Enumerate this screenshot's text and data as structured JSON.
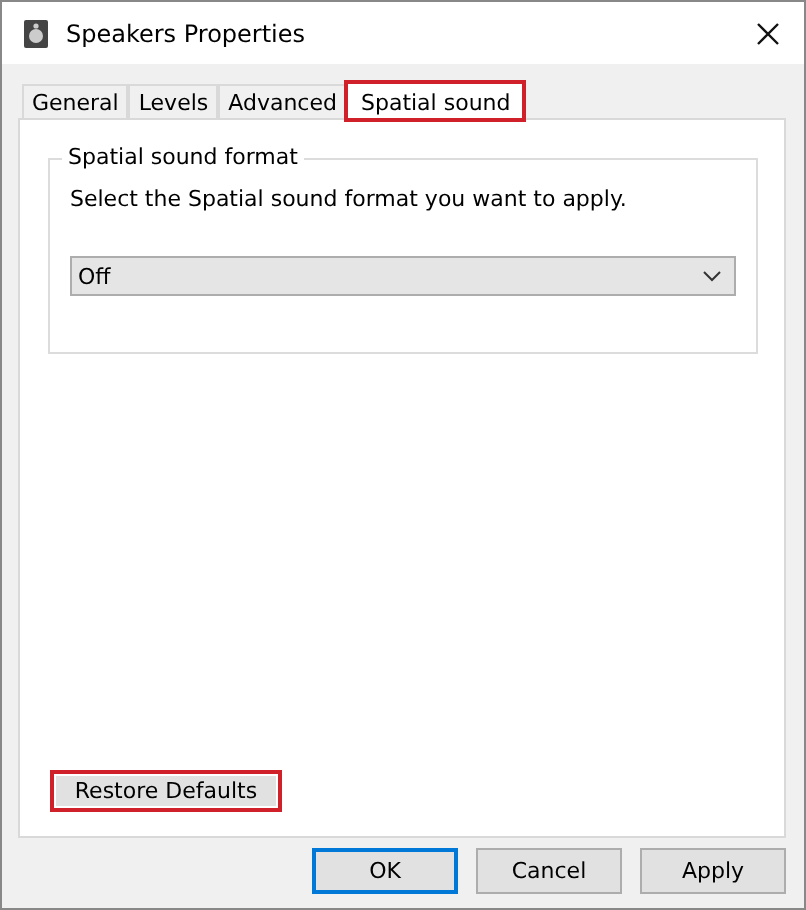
{
  "window": {
    "title": "Speakers Properties"
  },
  "tabs": [
    {
      "label": "General",
      "selected": false,
      "highlighted": false
    },
    {
      "label": "Levels",
      "selected": false,
      "highlighted": false
    },
    {
      "label": "Advanced",
      "selected": false,
      "highlighted": false
    },
    {
      "label": "Spatial sound",
      "selected": true,
      "highlighted": true
    }
  ],
  "group": {
    "title": "Spatial sound format",
    "instruction": "Select the Spatial sound format you want to apply.",
    "dropdown": {
      "value": "Off"
    }
  },
  "restore_button": {
    "label": "Restore Defaults",
    "highlighted": true
  },
  "buttons": [
    {
      "label": "OK",
      "default": true
    },
    {
      "label": "Cancel",
      "default": false
    },
    {
      "label": "Apply",
      "default": false
    }
  ]
}
